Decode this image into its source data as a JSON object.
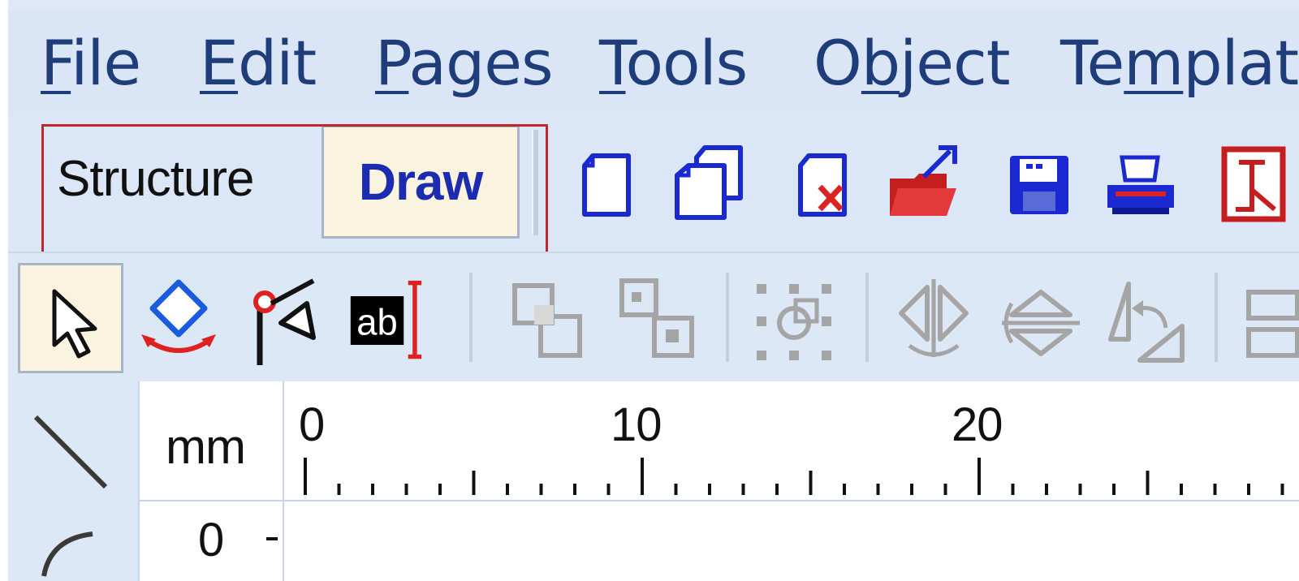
{
  "menu": {
    "file": {
      "pre": "",
      "u": "F",
      "post": "ile"
    },
    "edit": {
      "pre": "",
      "u": "E",
      "post": "dit"
    },
    "pages": {
      "pre": "",
      "u": "P",
      "post": "ages"
    },
    "tools": {
      "pre": "",
      "u": "T",
      "post": "ools"
    },
    "object": {
      "pre": "O",
      "u": "b",
      "post": "ject"
    },
    "template": {
      "pre": "Te",
      "u": "m",
      "post": "plat"
    }
  },
  "mode_tabs": {
    "structure": "Structure",
    "draw": "Draw",
    "active": "Draw"
  },
  "toolbar_icons": [
    "new-page-icon",
    "duplicate-page-icon",
    "delete-page-icon",
    "open-folder-icon",
    "save-icon",
    "print-icon",
    "pdf-icon"
  ],
  "draw_tools": [
    "select-arrow-icon",
    "rotate-object-icon",
    "connector-icon",
    "text-box-icon",
    "group-icon",
    "ungroup-icon",
    "arrange-icon",
    "flip-vertical-icon",
    "flip-horizontal-icon",
    "rotate-90-icon"
  ],
  "ruler": {
    "unit": "mm",
    "ticks": [
      "0",
      "10",
      "20"
    ],
    "vertical_ticks": [
      "0"
    ]
  },
  "colors": {
    "accent_blue": "#1c2cb0",
    "highlight_red": "#c0262d",
    "active_tab_bg": "#faf3df"
  }
}
